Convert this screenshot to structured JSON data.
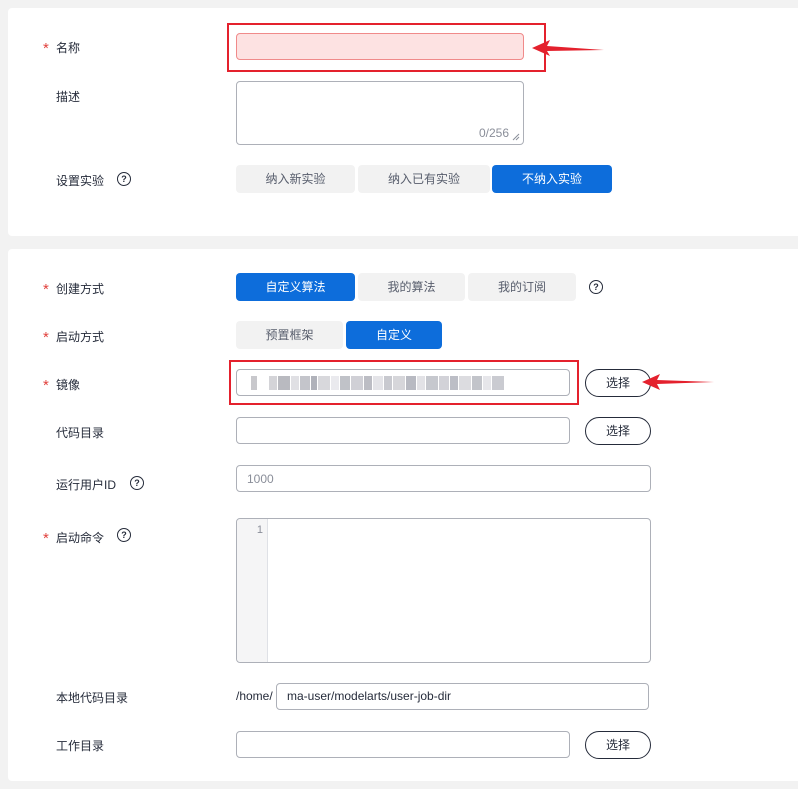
{
  "form1": {
    "name": {
      "label": "名称",
      "required": "*",
      "value": ""
    },
    "description": {
      "label": "描述",
      "counter": "0/256"
    },
    "experiment": {
      "label": "设置实验",
      "help": "?",
      "options": [
        "纳入新实验",
        "纳入已有实验",
        "不纳入实验"
      ],
      "selected": "不纳入实验"
    }
  },
  "form2": {
    "create_method": {
      "label": "创建方式",
      "required": "*",
      "help": "?",
      "options": [
        "自定义算法",
        "我的算法",
        "我的订阅"
      ],
      "selected": "自定义算法"
    },
    "boot_method": {
      "label": "启动方式",
      "required": "*",
      "options": [
        "预置框架",
        "自定义"
      ],
      "selected": "自定义"
    },
    "image": {
      "label": "镜像",
      "required": "*",
      "select_label": "选择"
    },
    "code_dir": {
      "label": "代码目录",
      "value": "",
      "select_label": "选择"
    },
    "run_user_id": {
      "label": "运行用户ID",
      "help": "?",
      "placeholder": "1000"
    },
    "boot_command": {
      "label": "启动命令",
      "required": "*",
      "help": "?",
      "line_number": "1"
    },
    "local_code_dir": {
      "label": "本地代码目录",
      "prefix": "/home/",
      "value": "ma-user/modelarts/user-job-dir"
    },
    "work_dir": {
      "label": "工作目录",
      "value": "",
      "select_label": "选择"
    }
  },
  "colors": {
    "accent": "#0d6ddb",
    "annotation_red": "#e4212d",
    "required_star": "#e1413c",
    "error_fill": "#fde2e2"
  }
}
